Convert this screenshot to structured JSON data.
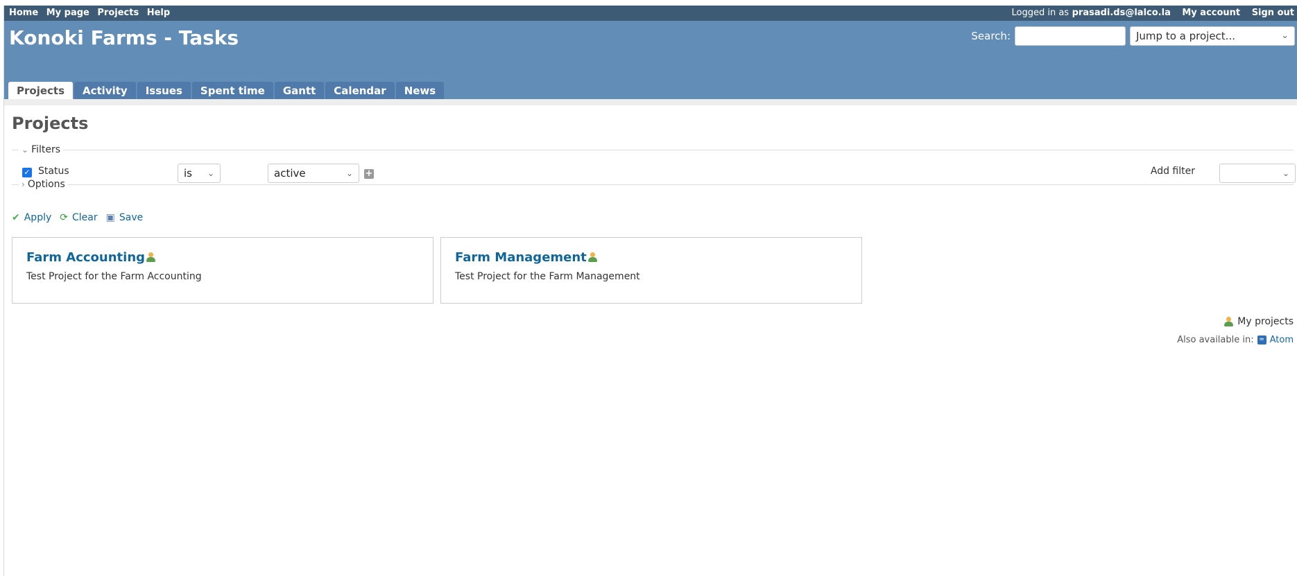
{
  "top_menu": {
    "items": [
      "Home",
      "My page",
      "Projects",
      "Help"
    ],
    "logged_in_prefix": "Logged in as",
    "user": "prasadi.ds@lalco.la",
    "my_account": "My account",
    "sign_out": "Sign out"
  },
  "header": {
    "title": "Konoki Farms - Tasks",
    "search_label": "Search:",
    "search_value": "",
    "jump_placeholder": "Jump to a project...",
    "tabs": [
      "Projects",
      "Activity",
      "Issues",
      "Spent time",
      "Gantt",
      "Calendar",
      "News"
    ],
    "selected_tab": "Projects"
  },
  "page": {
    "title": "Projects",
    "filters_legend": "Filters",
    "options_legend": "Options",
    "filter": {
      "checked": true,
      "label": "Status",
      "operator": "is",
      "value": "active"
    },
    "add_filter_label": "Add filter",
    "add_filter_value": "",
    "actions": {
      "apply": "Apply",
      "clear": "Clear",
      "save": "Save"
    },
    "projects": [
      {
        "name": "Farm Accounting",
        "description": "Test Project for the Farm Accounting"
      },
      {
        "name": "Farm Management",
        "description": "Test Project for the Farm Management"
      }
    ],
    "my_projects": "My projects",
    "also_available": "Also available in:",
    "atom": "Atom"
  },
  "colors": {
    "top_menu_bg": "#3e5b76",
    "header_bg": "#628db6",
    "tab_bg": "#507aaa",
    "link": "#116699"
  },
  "icons": [
    "check-icon",
    "clear-icon",
    "save-icon",
    "user-icon",
    "feed-icon",
    "chevron-down-icon",
    "plus-icon"
  ]
}
